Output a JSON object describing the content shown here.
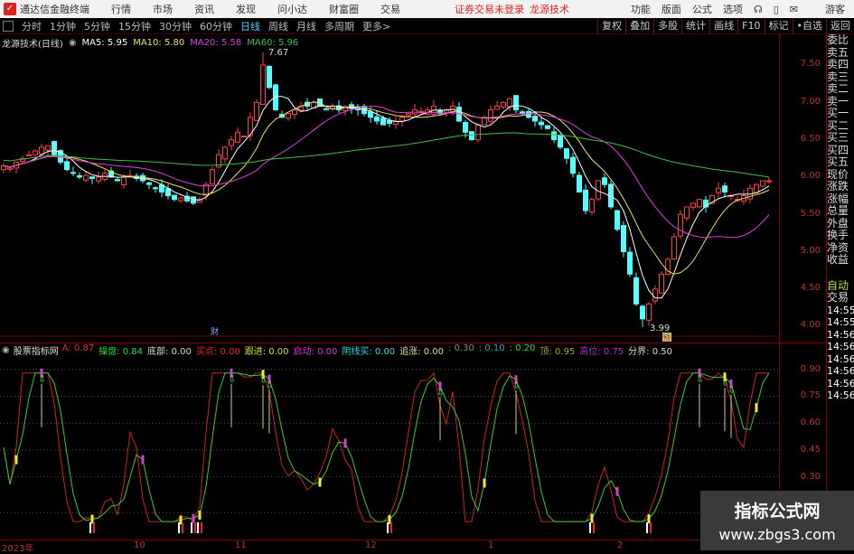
{
  "titlebar": {
    "app": "通达信金融终端",
    "menus": [
      "行情",
      "市场",
      "资讯",
      "发现",
      "问小达",
      "财富圈",
      "交易"
    ],
    "notice": "证券交易未登录",
    "brand": "龙源技术",
    "right": [
      "功能",
      "版面",
      "公式",
      "选项"
    ],
    "user": "游客"
  },
  "toolbar": {
    "periods": [
      "分时",
      "1分钟",
      "5分钟",
      "15分钟",
      "30分钟",
      "60分钟",
      "日线",
      "周线",
      "月线",
      "多周期",
      "更多>"
    ],
    "active": "日线",
    "buttons": [
      "复权",
      "叠加",
      "多股",
      "统计",
      "画线",
      "F10",
      "标记",
      "•自选",
      "返回"
    ]
  },
  "chart_header": {
    "title": "龙源技术(日线)",
    "ma5": "MA5: 5.95",
    "ma10": "MA10: 5.80",
    "ma20": "MA20: 5.58",
    "ma60": "MA60: 5.96"
  },
  "price_axis": [
    "7.50",
    "7.00",
    "6.50",
    "6.00",
    "5.50",
    "5.00",
    "4.50",
    "4.00"
  ],
  "annotations": {
    "high": "7.67",
    "low": "3.99",
    "marker1": "财",
    "marker2": "预"
  },
  "indicator_header": {
    "name": "股票指标网",
    "items": [
      {
        "t": "A: 0.87",
        "c": "#d33"
      },
      {
        "t": "操盘: 0.84",
        "c": "#3d3"
      },
      {
        "t": "底部: 0.00",
        "c": "#ddd"
      },
      {
        "t": "买点: 0.00",
        "c": "#e22"
      },
      {
        "t": "跟进: 0.00",
        "c": "#dd3"
      },
      {
        "t": "启动: 0.00",
        "c": "#d3d"
      },
      {
        "t": "阴线买: 0.00",
        "c": "#3dd"
      },
      {
        "t": "追涨: 0.00",
        "c": "#dd8"
      },
      {
        "t": ": 0.30",
        "c": "#888"
      },
      {
        "t": ": 0.10",
        "c": "#3aa"
      },
      {
        "t": ": 0.20",
        "c": "#3d3"
      },
      {
        "t": "顶: 0.95",
        "c": "#aa3"
      },
      {
        "t": "高位: 0.75",
        "c": "#a3c"
      },
      {
        "t": "分界: 0.50",
        "c": "#ddd"
      }
    ]
  },
  "indicator_axis": [
    "0.90",
    "0.75",
    "0.60",
    "0.45",
    "0.30"
  ],
  "date_axis": [
    "2023年",
    "10",
    "11",
    "12",
    "1",
    "2"
  ],
  "right_panel": {
    "labels": [
      "委比",
      "卖五",
      "卖四",
      "卖三",
      "卖二",
      "卖一",
      "买一",
      "买二",
      "买三",
      "买四",
      "买五",
      "现价",
      "涨跌",
      "涨幅",
      "总量",
      "外盘",
      "换手",
      "净资",
      "收益"
    ],
    "auto": "自动",
    "trade": "交易",
    "times": [
      "14:55",
      "14:55",
      "14:56",
      "14:56",
      "14:56",
      "14:56",
      "14:56",
      "14:56"
    ]
  },
  "watermark": {
    "title": "指标公式网",
    "url": "www.zbgs3.com"
  },
  "colors": {
    "up": "#ff4040",
    "down": "#54ffff",
    "ma5": "#ffffff",
    "ma10": "#f0e060",
    "ma20": "#e040e0",
    "ma60": "#40c040"
  },
  "chart_data": {
    "type": "candlestick",
    "closes": [
      6.15,
      6.12,
      6.2,
      6.25,
      6.3,
      6.35,
      6.4,
      6.42,
      6.3,
      6.2,
      6.1,
      6.05,
      6.0,
      6.02,
      5.98,
      6.0,
      6.05,
      6.0,
      5.95,
      6.0,
      6.02,
      5.98,
      5.95,
      5.9,
      5.85,
      5.8,
      5.75,
      5.7,
      5.72,
      5.68,
      5.65,
      5.7,
      5.9,
      6.1,
      6.3,
      6.4,
      6.5,
      6.6,
      6.55,
      6.8,
      7.0,
      7.5,
      7.2,
      6.9,
      6.8,
      6.85,
      6.9,
      6.95,
      6.95,
      7.0,
      6.95,
      6.9,
      6.95,
      6.9,
      6.95,
      6.92,
      6.9,
      6.85,
      6.8,
      6.75,
      6.7,
      6.72,
      6.75,
      6.8,
      6.85,
      6.9,
      6.88,
      6.9,
      6.95,
      6.85,
      6.9,
      6.95,
      6.75,
      6.6,
      6.5,
      6.7,
      6.8,
      6.9,
      6.95,
      7.0,
      7.05,
      6.9,
      6.85,
      6.8,
      6.75,
      6.7,
      6.65,
      6.5,
      6.4,
      6.25,
      6.05,
      5.8,
      5.55,
      5.7,
      5.95,
      5.9,
      5.6,
      5.3,
      5.0,
      4.7,
      4.3,
      4.1,
      4.3,
      4.5,
      4.7,
      4.9,
      5.2,
      5.5,
      5.6,
      5.65,
      5.7,
      5.6,
      5.75,
      5.85,
      5.8,
      5.75,
      5.7,
      5.75,
      5.85,
      5.9,
      5.95,
      5.95
    ],
    "high": 7.67,
    "low": 3.99,
    "ylim": [
      3.9,
      7.7
    ],
    "indicator_ylim": [
      0,
      1
    ]
  }
}
